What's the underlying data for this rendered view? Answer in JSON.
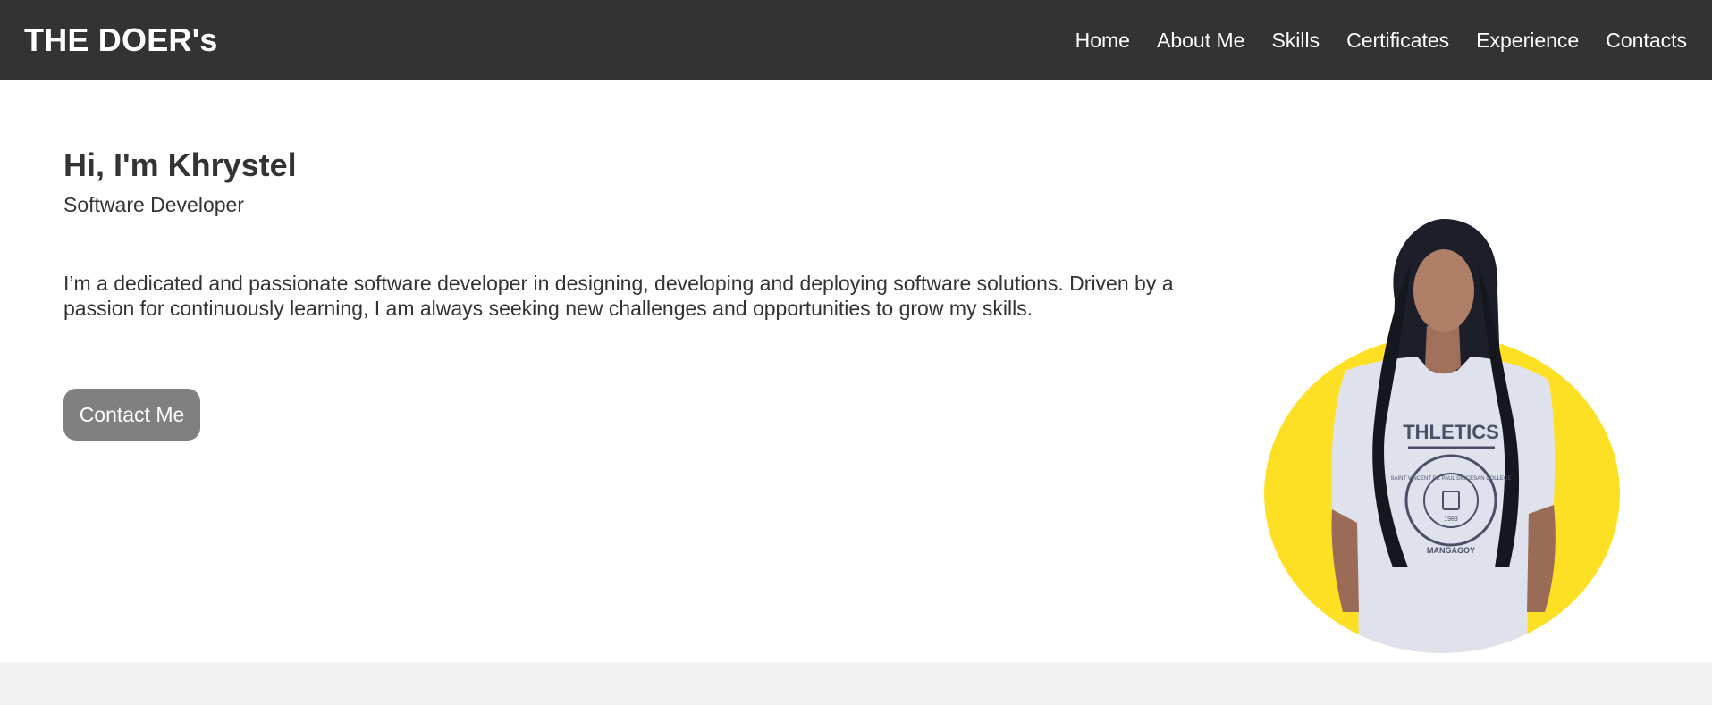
{
  "navbar": {
    "brand": "THE DOER's",
    "links": [
      {
        "label": "Home"
      },
      {
        "label": "About Me"
      },
      {
        "label": "Skills"
      },
      {
        "label": "Certificates"
      },
      {
        "label": "Experience"
      },
      {
        "label": "Contacts"
      }
    ]
  },
  "hero": {
    "greeting": "Hi, I'm Khrystel",
    "role": "Software Developer",
    "bio": "I’m a dedicated and passionate software developer in designing, developing and deploying software solutions. Driven by a passion for continuously learning, I am always seeking new challenges and opportunities to grow my skills.",
    "cta_label": "Contact Me",
    "portrait_alt": "profile-photo",
    "portrait_print_lines": [
      "THLETICS",
      "SAINT VINCENT DE PAUL DIOCESAN COLLEGE",
      "MANGAGOY",
      "1983"
    ]
  },
  "colors": {
    "navbar_bg": "#333333",
    "text": "#333333",
    "button_bg": "#808080",
    "accent_circle": "#fde023",
    "footer_band": "#f2f2f2"
  }
}
